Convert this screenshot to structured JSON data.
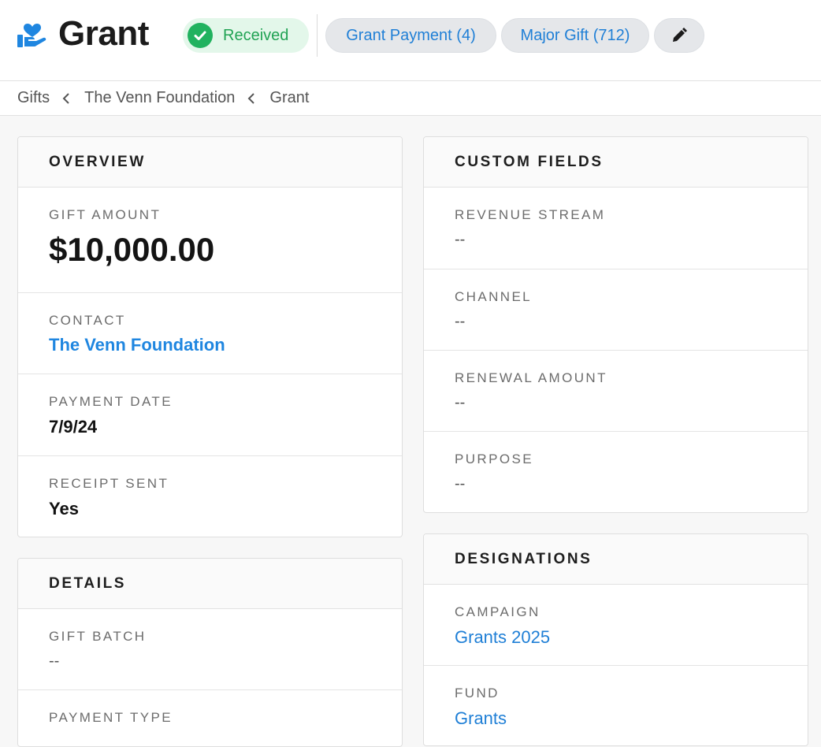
{
  "header": {
    "title": "Grant",
    "logo_icon": "hand-heart-icon",
    "status": {
      "label": "Received",
      "color": "#21b25f"
    },
    "pills": [
      {
        "label": "Grant Payment (4)"
      },
      {
        "label": "Major Gift (712)"
      }
    ],
    "edit_icon": "pencil-icon"
  },
  "breadcrumb": {
    "items": [
      "Gifts",
      "The Venn Foundation",
      "Grant"
    ]
  },
  "overview": {
    "heading": "OVERVIEW",
    "gift_amount": {
      "label": "GIFT AMOUNT",
      "value": "$10,000.00"
    },
    "contact": {
      "label": "CONTACT",
      "value": "The Venn Foundation"
    },
    "payment_date": {
      "label": "PAYMENT DATE",
      "value": "7/9/24"
    },
    "receipt_sent": {
      "label": "RECEIPT SENT",
      "value": "Yes"
    }
  },
  "details": {
    "heading": "DETAILS",
    "gift_batch": {
      "label": "GIFT BATCH",
      "value": "--"
    },
    "payment_type": {
      "label": "PAYMENT TYPE"
    }
  },
  "custom_fields": {
    "heading": "CUSTOM FIELDS",
    "revenue_stream": {
      "label": "REVENUE STREAM",
      "value": "--"
    },
    "channel": {
      "label": "CHANNEL",
      "value": "--"
    },
    "renewal_amount": {
      "label": "RENEWAL AMOUNT",
      "value": "--"
    },
    "purpose": {
      "label": "PURPOSE",
      "value": "--"
    }
  },
  "designations": {
    "heading": "DESIGNATIONS",
    "campaign": {
      "label": "CAMPAIGN",
      "value": "Grants 2025"
    },
    "fund": {
      "label": "FUND",
      "value": "Grants"
    }
  },
  "colors": {
    "accent": "#1f7fd6",
    "success": "#21b25f",
    "success_bg": "#e3f7ea"
  }
}
